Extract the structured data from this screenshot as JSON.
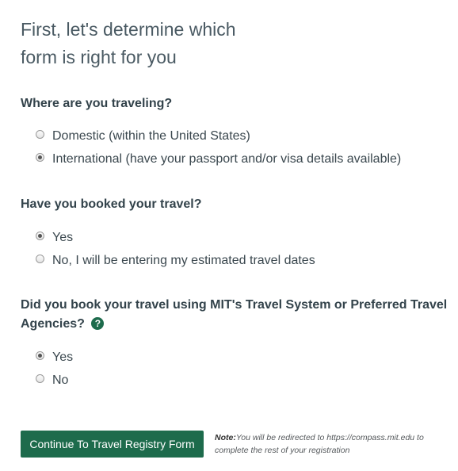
{
  "heading": {
    "line1": "First, let's determine which",
    "line2": "form is right for you"
  },
  "questions": [
    {
      "label": "Where are you traveling?",
      "options": [
        {
          "label": "Domestic (within the United States)",
          "selected": false
        },
        {
          "label": "International (have your passport and/or visa details available)",
          "selected": true
        }
      ]
    },
    {
      "label": "Have you booked your travel?",
      "options": [
        {
          "label": "Yes",
          "selected": true
        },
        {
          "label": "No, I will be entering my estimated travel dates",
          "selected": false
        }
      ]
    },
    {
      "label": "Did you book your travel using MIT's Travel System or Preferred Travel Agencies?",
      "help_icon": "question-circle-icon",
      "options": [
        {
          "label": "Yes",
          "selected": true
        },
        {
          "label": "No",
          "selected": false
        }
      ]
    }
  ],
  "continue_button": {
    "label": "Continue To Travel Registry Form",
    "color": "#1d6b4c"
  },
  "note": {
    "prefix": "Note:",
    "text": "You will be redirected to https://compass.mit.edu to complete the rest of your registration"
  }
}
